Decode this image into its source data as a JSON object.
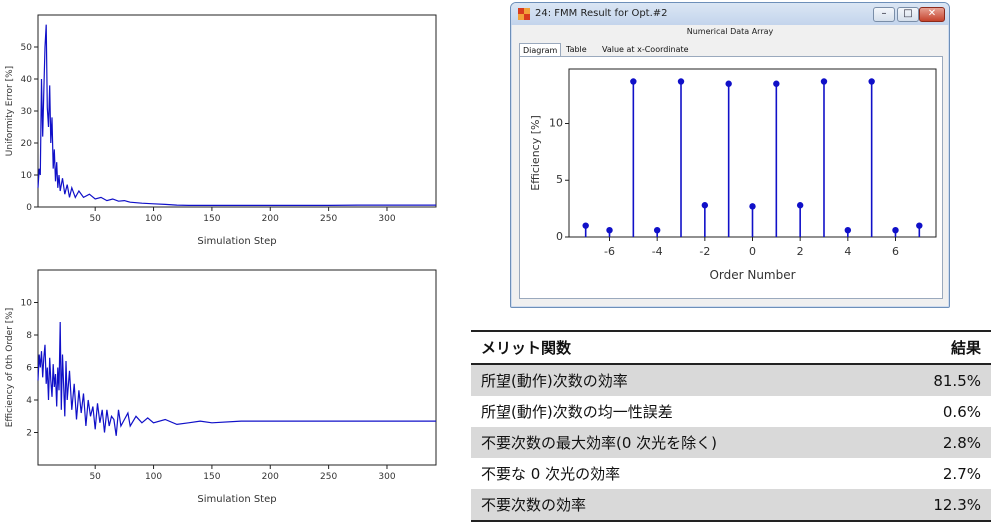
{
  "chart_data": [
    {
      "type": "line",
      "xlabel": "Simulation Step",
      "ylabel": "Uniformity Error [%]",
      "xticks": [
        50,
        100,
        150,
        200,
        250,
        300
      ],
      "yticks": [
        0,
        10,
        20,
        30,
        40,
        50
      ],
      "xlim": [
        1,
        342
      ],
      "ylim": [
        0,
        60
      ],
      "color": "#1010c8",
      "series": [
        {
          "x": [
            1,
            2,
            3,
            4,
            5,
            6,
            7,
            8,
            9,
            10,
            11,
            12,
            13,
            14,
            15,
            16,
            17,
            18,
            19,
            20,
            22,
            24,
            26,
            28,
            30,
            33,
            36,
            40,
            45,
            50,
            55,
            60,
            65,
            70,
            75,
            80,
            90,
            100,
            110,
            120,
            130,
            140,
            150,
            175,
            200,
            225,
            250,
            275,
            300,
            342
          ],
          "y": [
            6,
            12,
            10,
            40,
            22,
            36,
            50,
            57,
            31,
            25,
            38,
            20,
            28,
            12,
            18,
            8,
            14,
            6,
            10,
            5,
            9,
            4,
            7,
            3,
            6,
            3,
            5,
            3,
            4,
            2.5,
            3,
            2,
            2.5,
            1.8,
            2,
            1.5,
            1.2,
            1,
            0.8,
            0.6,
            0.5,
            0.5,
            0.5,
            0.5,
            0.5,
            0.5,
            0.5,
            0.6,
            0.6,
            0.6
          ]
        }
      ]
    },
    {
      "type": "line",
      "xlabel": "Simulation Step",
      "ylabel": "Efficiency of 0th Order [%]",
      "xticks": [
        50,
        100,
        150,
        200,
        250,
        300
      ],
      "yticks": [
        2,
        4,
        6,
        8,
        10
      ],
      "xlim": [
        1,
        342
      ],
      "ylim": [
        0,
        12
      ],
      "color": "#1010c8",
      "series": [
        {
          "x": [
            1,
            2,
            3,
            4,
            5,
            6,
            7,
            8,
            9,
            10,
            11,
            12,
            13,
            14,
            15,
            16,
            17,
            18,
            19,
            20,
            21,
            22,
            23,
            24,
            25,
            26,
            28,
            30,
            32,
            34,
            36,
            38,
            40,
            42,
            44,
            46,
            48,
            50,
            52,
            54,
            56,
            58,
            60,
            62,
            64,
            66,
            68,
            70,
            72,
            75,
            78,
            80,
            85,
            90,
            95,
            100,
            110,
            120,
            130,
            140,
            150,
            175,
            200,
            250,
            300,
            342
          ],
          "y": [
            5.2,
            6.8,
            6.0,
            7.0,
            5.4,
            6.6,
            7.4,
            5.0,
            6.0,
            4.0,
            6.6,
            5.2,
            4.2,
            6.2,
            4.8,
            5.6,
            3.6,
            6.0,
            4.6,
            8.8,
            3.4,
            6.8,
            4.8,
            3.0,
            6.4,
            4.0,
            5.8,
            3.4,
            5.0,
            2.8,
            4.6,
            3.2,
            4.4,
            2.4,
            4.0,
            3.0,
            3.6,
            2.2,
            3.8,
            2.6,
            3.4,
            2.0,
            3.4,
            2.4,
            3.0,
            2.8,
            1.8,
            3.4,
            2.4,
            2.8,
            3.2,
            2.4,
            3.0,
            2.6,
            2.9,
            2.6,
            2.8,
            2.5,
            2.6,
            2.7,
            2.6,
            2.7,
            2.7,
            2.7,
            2.7,
            2.7
          ]
        }
      ]
    },
    {
      "type": "scatter",
      "xlabel": "Order Number",
      "ylabel": "Efficiency [%]",
      "xticks": [
        -6,
        -4,
        -2,
        0,
        2,
        4,
        6
      ],
      "yticks": [
        0,
        5,
        10
      ],
      "xlim": [
        -7.7,
        7.7
      ],
      "ylim": [
        0,
        14.8
      ],
      "color": "#1010c8",
      "series": [
        {
          "x": [
            -7,
            -6,
            -5,
            -4,
            -3,
            -2,
            -1,
            0,
            1,
            2,
            3,
            4,
            5,
            6,
            7
          ],
          "y": [
            1.0,
            0.6,
            13.7,
            0.6,
            13.7,
            2.8,
            13.5,
            2.7,
            13.5,
            2.8,
            13.7,
            0.6,
            13.7,
            0.6,
            1.0
          ]
        }
      ]
    }
  ],
  "fmm_window": {
    "title": "24: FMM Result for Opt.#2",
    "subheader": "Numerical Data Array",
    "tabs": [
      "Diagram",
      "Table",
      "Value at x-Coordinate"
    ],
    "buttons": {
      "minimize": "–",
      "maximize": "□",
      "close": "✕"
    }
  },
  "merit_table": {
    "headers": [
      "メリット関数",
      "結果"
    ],
    "rows": [
      {
        "name": "所望(動作)次数の効率",
        "value": "81.5%"
      },
      {
        "name": "所望(動作)次数の均一性誤差",
        "value": "0.6%"
      },
      {
        "name": "不要次数の最大効率(0 次光を除く)",
        "value": "2.8%"
      },
      {
        "name": "不要な 0 次光の効率",
        "value": "2.7%"
      },
      {
        "name": "不要次数の効率",
        "value": "12.3%"
      }
    ]
  }
}
